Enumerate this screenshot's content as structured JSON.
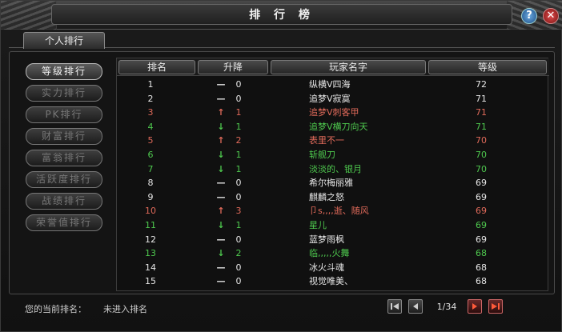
{
  "window": {
    "title": "排 行 榜",
    "help_label": "?",
    "close_label": "✕"
  },
  "tabs": [
    {
      "label": "个人排行",
      "active": true
    }
  ],
  "menu": [
    {
      "label": "等级排行",
      "active": true
    },
    {
      "label": "实力排行",
      "active": false
    },
    {
      "label": "PK排行",
      "active": false
    },
    {
      "label": "财富排行",
      "active": false
    },
    {
      "label": "富翁排行",
      "active": false
    },
    {
      "label": "活跃度排行",
      "active": false
    },
    {
      "label": "战绩排行",
      "active": false
    },
    {
      "label": "荣誉值排行",
      "active": false
    }
  ],
  "table": {
    "headers": {
      "rank": "排名",
      "change": "升降",
      "name": "玩家名字",
      "level": "等级"
    },
    "rows": [
      {
        "rank": "1",
        "arrow": "—",
        "delta": "0",
        "name": "纵横V四海",
        "level": "72",
        "trend": "same"
      },
      {
        "rank": "2",
        "arrow": "—",
        "delta": "0",
        "name": "追梦V寂寞",
        "level": "71",
        "trend": "same"
      },
      {
        "rank": "3",
        "arrow": "↑",
        "delta": "1",
        "name": "追梦V刺客甲",
        "level": "71",
        "trend": "up"
      },
      {
        "rank": "4",
        "arrow": "↓",
        "delta": "1",
        "name": "追梦V横刀向天",
        "level": "71",
        "trend": "down"
      },
      {
        "rank": "5",
        "arrow": "↑",
        "delta": "2",
        "name": "表里不一",
        "level": "70",
        "trend": "up"
      },
      {
        "rank": "6",
        "arrow": "↓",
        "delta": "1",
        "name": "斩舰刀",
        "level": "70",
        "trend": "down"
      },
      {
        "rank": "7",
        "arrow": "↓",
        "delta": "1",
        "name": "淡淡的、银月",
        "level": "70",
        "trend": "down"
      },
      {
        "rank": "8",
        "arrow": "—",
        "delta": "0",
        "name": "希尔梅丽雅",
        "level": "69",
        "trend": "same"
      },
      {
        "rank": "9",
        "arrow": "—",
        "delta": "0",
        "name": "麒麟之怒",
        "level": "69",
        "trend": "same"
      },
      {
        "rank": "10",
        "arrow": "↑",
        "delta": "3",
        "name": "卩s,,,,逝、随风",
        "level": "69",
        "trend": "up"
      },
      {
        "rank": "11",
        "arrow": "↓",
        "delta": "1",
        "name": "星儿",
        "level": "69",
        "trend": "down"
      },
      {
        "rank": "12",
        "arrow": "—",
        "delta": "0",
        "name": "蓝梦雨枫",
        "level": "69",
        "trend": "same"
      },
      {
        "rank": "13",
        "arrow": "↓",
        "delta": "2",
        "name": "临,,,,,火舞",
        "level": "68",
        "trend": "down"
      },
      {
        "rank": "14",
        "arrow": "—",
        "delta": "0",
        "name": "冰火斗魂",
        "level": "68",
        "trend": "same"
      },
      {
        "rank": "15",
        "arrow": "—",
        "delta": "0",
        "name": "视觉唯美、",
        "level": "68",
        "trend": "same"
      }
    ]
  },
  "footer": {
    "current_rank_label": "您的当前排名：",
    "current_rank_value": "未进入排名",
    "page_indicator": "1/34"
  },
  "colors": {
    "up": "#e06a5a",
    "down": "#4ec84e",
    "same": "#e6e6e6"
  }
}
